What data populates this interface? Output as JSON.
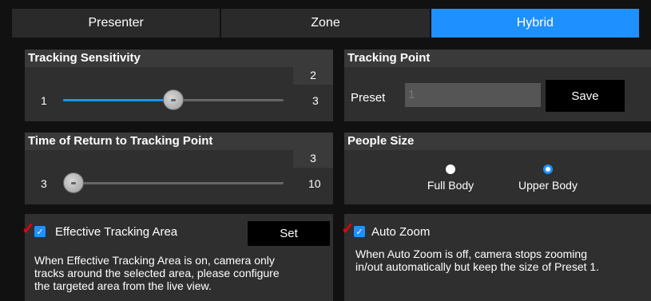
{
  "tabs": [
    {
      "label": "Presenter",
      "active": false
    },
    {
      "label": "Zone",
      "active": false
    },
    {
      "label": "Hybrid",
      "active": true
    }
  ],
  "sensitivity": {
    "title": "Tracking Sensitivity",
    "value": "2",
    "min": "1",
    "max": "3",
    "level": 0.5
  },
  "tracking_point": {
    "title": "Tracking Point",
    "preset_label": "Preset",
    "preset_value": "1",
    "save_label": "Save"
  },
  "return_time": {
    "title": "Time of Return to Tracking Point",
    "value": "3",
    "min": "3",
    "max": "10",
    "level": 0.0
  },
  "people_size": {
    "title": "People Size",
    "options": [
      "Full Body",
      "Upper Body"
    ],
    "selected": "Upper Body"
  },
  "effective_area": {
    "label": "Effective Tracking Area",
    "checked": true,
    "set_label": "Set",
    "desc": [
      "When Effective Tracking Area is on, camera only",
      "tracks around the selected area, please configure",
      "the targeted area from the live view."
    ]
  },
  "auto_zoom": {
    "label": "Auto Zoom",
    "checked": true,
    "desc": [
      "When Auto Zoom is off, camera stops zooming",
      "in/out automatically but keep the size of Preset 1."
    ]
  },
  "colors": {
    "accent": "#1e90ff",
    "panel": "#2f2f2f",
    "header": "#3a3a3a",
    "mark": "#e00000"
  }
}
